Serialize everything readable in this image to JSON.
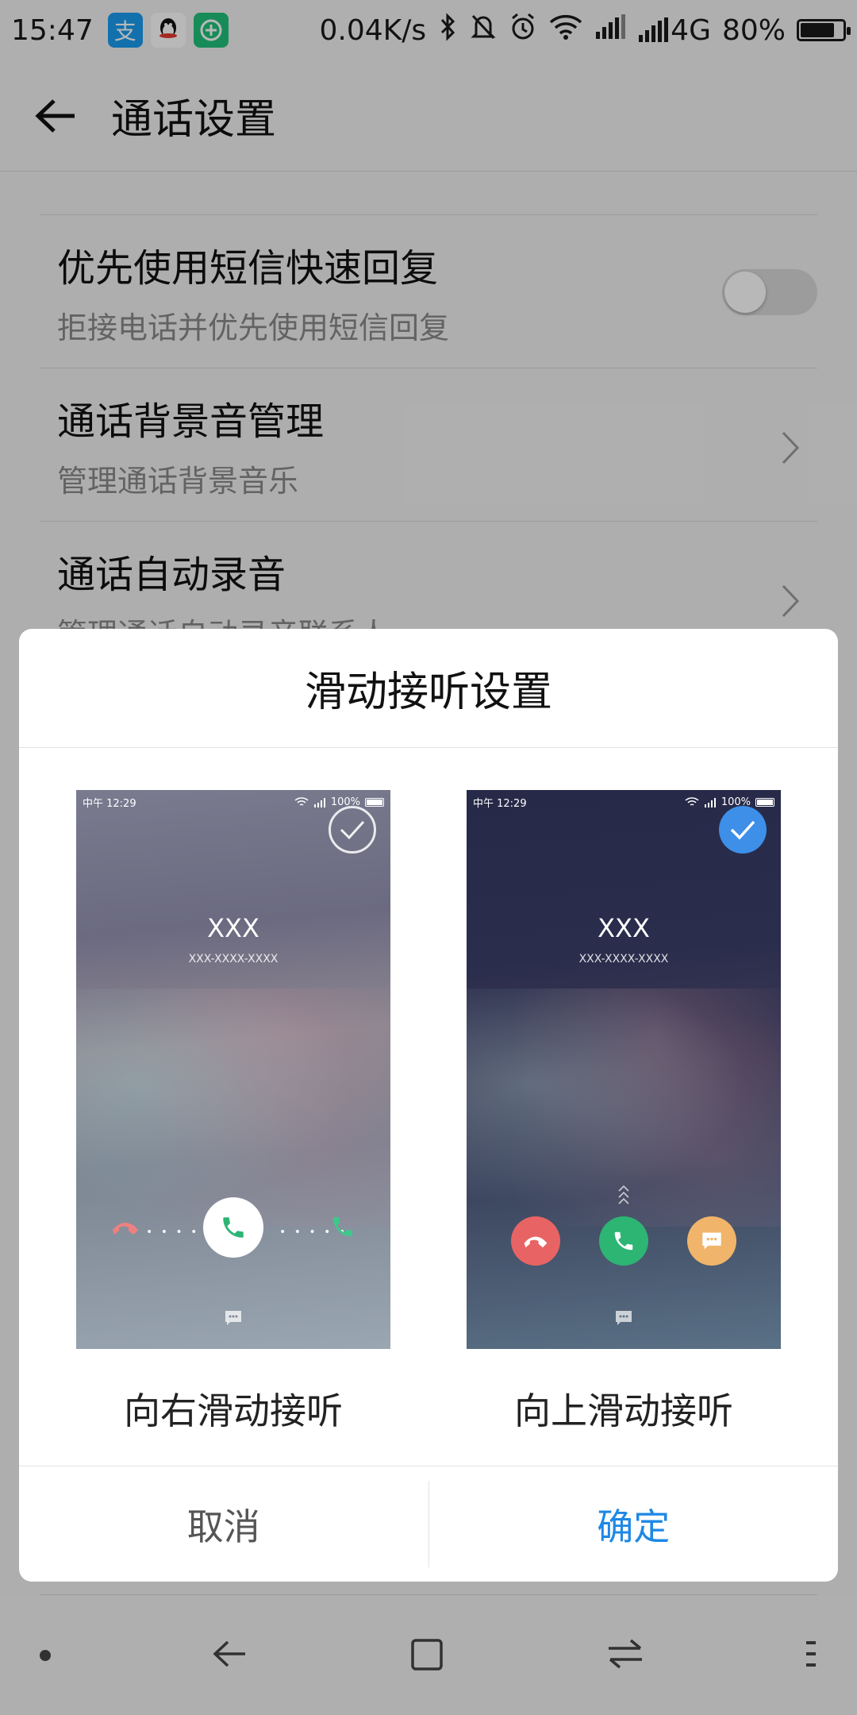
{
  "status_bar": {
    "time": "15:47",
    "network_speed": "0.04K/s",
    "network_type": "4G",
    "battery_percent": "80%",
    "battery_level": 0.8,
    "app_icons": [
      "alipay-icon",
      "qq-icon",
      "add-circle-icon"
    ]
  },
  "app_bar": {
    "title": "通话设置"
  },
  "settings": {
    "items": [
      {
        "title": "优先使用短信快速回复",
        "subtitle": "拒接电话并优先使用短信回复",
        "control": "toggle",
        "value": false
      },
      {
        "title": "通话背景音管理",
        "subtitle": "管理通话背景音乐",
        "control": "chevron"
      },
      {
        "title": "通话自动录音",
        "subtitle": "管理通话自动录音联系人",
        "control": "chevron"
      }
    ]
  },
  "dialog": {
    "title": "滑动接听设置",
    "options": [
      {
        "label": "向右滑动接听",
        "selected": false,
        "preview": {
          "time": "中午 12:29",
          "battery": "100%",
          "caller": "XXX",
          "number": "XXX-XXXX-XXXX"
        }
      },
      {
        "label": "向上滑动接听",
        "selected": true,
        "preview": {
          "time": "中午 12:29",
          "battery": "100%",
          "caller": "XXX",
          "number": "XXX-XXXX-XXXX"
        }
      }
    ],
    "cancel_label": "取消",
    "ok_label": "确定"
  },
  "colors": {
    "accent": "#1e88e5",
    "check_selected": "#3d8fe8",
    "reject": "#e86464",
    "answer": "#2db574",
    "message": "#f0b56a"
  }
}
